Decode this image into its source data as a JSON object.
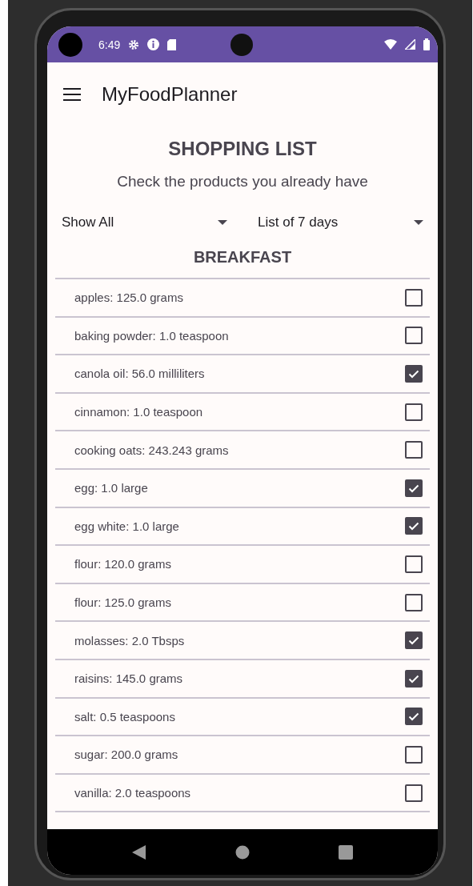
{
  "status_bar": {
    "time": "6:49"
  },
  "app_bar": {
    "title": "MyFoodPlanner"
  },
  "header": {
    "title": "SHOPPING LIST",
    "subtitle": "Check the products you already have"
  },
  "filters": [
    {
      "value": "Show All"
    },
    {
      "value": "List of 7 days"
    }
  ],
  "section": {
    "title": "BREAKFAST"
  },
  "items": [
    {
      "label": "apples: 125.0 grams",
      "checked": false
    },
    {
      "label": "baking powder: 1.0 teaspoon",
      "checked": false
    },
    {
      "label": "canola oil: 56.0 milliliters",
      "checked": true
    },
    {
      "label": "cinnamon: 1.0 teaspoon",
      "checked": false
    },
    {
      "label": "cooking oats: 243.243 grams",
      "checked": false
    },
    {
      "label": "egg: 1.0 large",
      "checked": true
    },
    {
      "label": "egg white: 1.0 large",
      "checked": true
    },
    {
      "label": "flour: 120.0 grams",
      "checked": false
    },
    {
      "label": "flour: 125.0 grams",
      "checked": false
    },
    {
      "label": "molasses: 2.0 Tbsps",
      "checked": true
    },
    {
      "label": "raisins: 145.0 grams",
      "checked": true
    },
    {
      "label": "salt: 0.5 teaspoons",
      "checked": true
    },
    {
      "label": "sugar: 200.0 grams",
      "checked": false
    },
    {
      "label": "vanilla: 2.0 teaspoons",
      "checked": false
    }
  ]
}
